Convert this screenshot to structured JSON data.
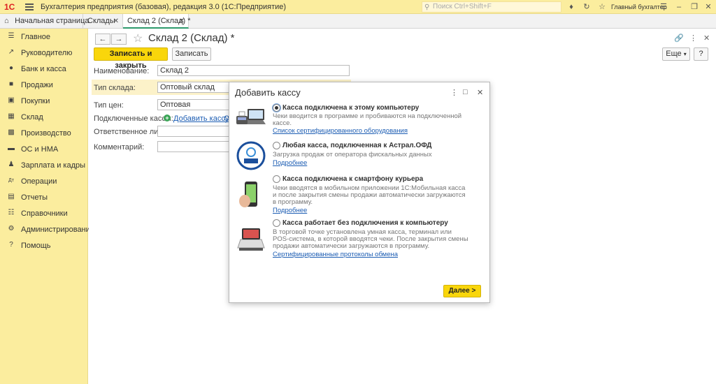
{
  "titlebar": {
    "logo": "1С",
    "app_title": "Бухгалтерия предприятия (базовая), редакция 3.0  (1С:Предприятие)",
    "search_placeholder": "Поиск Ctrl+Shift+F",
    "user": "Главный бухгалтер"
  },
  "tabs": [
    {
      "label": "Начальная страница"
    },
    {
      "label": "Склады"
    },
    {
      "label": "Склад 2 (Склад) *"
    }
  ],
  "sidebar": {
    "items": [
      {
        "label": "Главное",
        "icon": "menu-icon"
      },
      {
        "label": "Руководителю",
        "icon": "chart-line-icon"
      },
      {
        "label": "Банк и касса",
        "icon": "coins-icon"
      },
      {
        "label": "Продажи",
        "icon": "bag-icon"
      },
      {
        "label": "Покупки",
        "icon": "cart-icon"
      },
      {
        "label": "Склад",
        "icon": "warehouse-icon"
      },
      {
        "label": "Производство",
        "icon": "factory-icon"
      },
      {
        "label": "ОС и НМА",
        "icon": "truck-icon"
      },
      {
        "label": "Зарплата и кадры",
        "icon": "person-icon"
      },
      {
        "label": "Операции",
        "icon": "operations-icon"
      },
      {
        "label": "Отчеты",
        "icon": "report-icon"
      },
      {
        "label": "Справочники",
        "icon": "book-icon"
      },
      {
        "label": "Администрирование",
        "icon": "gear-icon"
      },
      {
        "label": "Помощь",
        "icon": "help-icon"
      }
    ]
  },
  "form": {
    "title": "Склад 2 (Склад) *",
    "save_close": "Записать и закрыть",
    "save": "Записать",
    "more": "Еще",
    "name_label": "Наименование:",
    "name_value": "Склад 2",
    "type_label": "Тип склада:",
    "type_value": "Оптовый склад",
    "price_label": "Тип цен:",
    "price_value": "Оптовая",
    "kassy_label": "Подключенные кассы:",
    "add_kassa": "Добавить кассу",
    "kassy_extra": "О",
    "resp_label": "Ответственное лицо:",
    "comment_label": "Комментарий:"
  },
  "dialog": {
    "title": "Добавить кассу",
    "next": "Далее >",
    "options": [
      {
        "title": "Касса подключена к этому компьютеру",
        "desc": "Чеки вводится в программе и пробиваются на подключенной кассе.",
        "link": "Список сертифицированного оборудования",
        "selected": true
      },
      {
        "title": "Любая касса, подключенная к Астрал.ОФД",
        "desc": "Загрузка продаж от оператора фискальных данных",
        "link": "Подробнее",
        "selected": false,
        "logo_text": "АСТРАЛ ОФД"
      },
      {
        "title": "Касса подключена к смартфону курьера",
        "desc": "Чеки вводятся в мобильном приложении 1С:Мобильная касса и после закрытия смены продажи автоматически загружаются в программу.",
        "link": "Подробнее",
        "selected": false
      },
      {
        "title": "Касса работает без подключения к компьютеру",
        "desc": "В торговой точке установлена умная касса, терминал или POS-система, в которой вводятся чеки. После закрытия смены продажи автоматически загружаются в программу.",
        "link": "Сертифицированные протоколы обмена",
        "selected": false
      }
    ]
  },
  "colors": {
    "accent_yellow": "#f9d60b",
    "panel_yellow": "#fbed9e",
    "link_blue": "#1c5db3",
    "active_tab_green": "#2d9a6c"
  }
}
